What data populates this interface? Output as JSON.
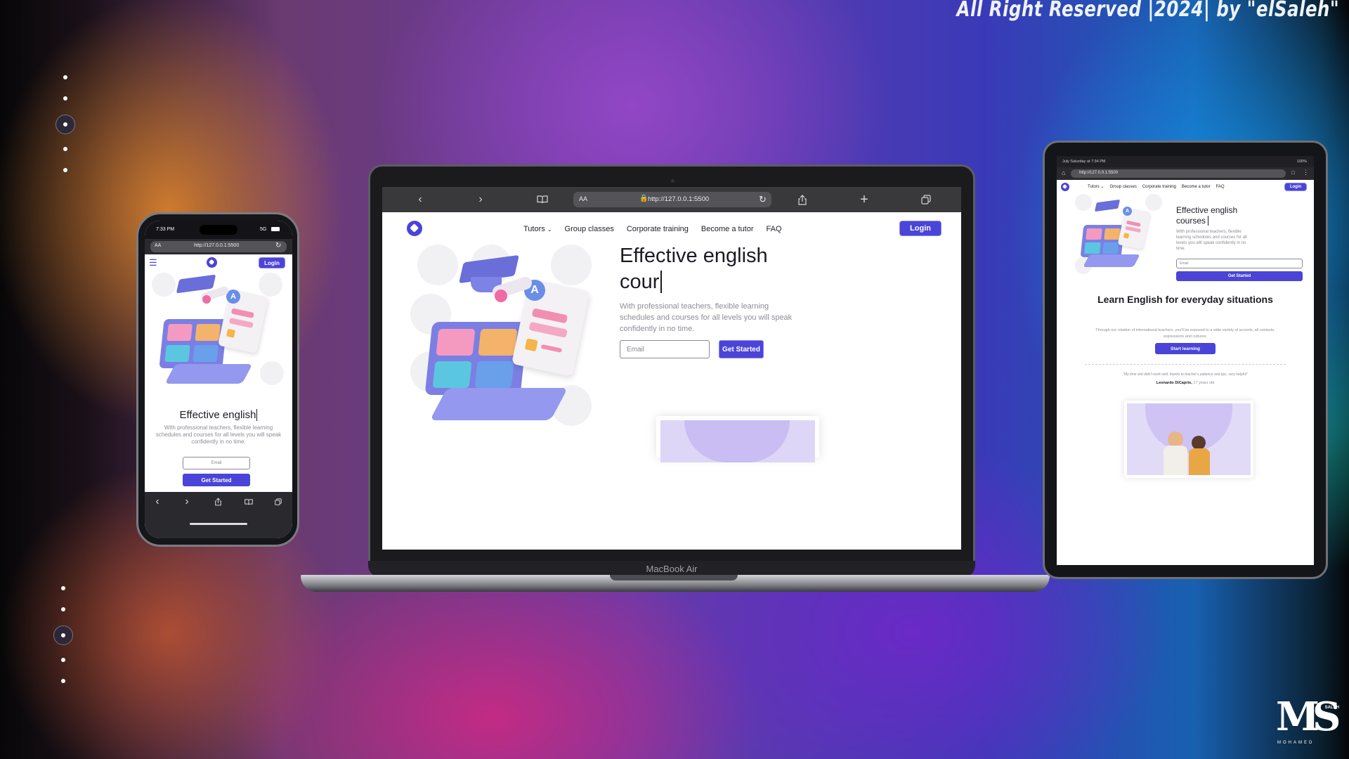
{
  "credit": "All Right Reserved |2024| by \"elSaleh\"",
  "brand": {
    "mark": "MS",
    "sub_top": "SALEH",
    "sub_bottom": "MOHAMED"
  },
  "colors": {
    "accent": "#4a44d8",
    "text": "#1b1b24"
  },
  "laptop": {
    "model": "MacBook Air",
    "browser": {
      "aa": "AA",
      "url": "http://127.0.0.1:5500"
    },
    "nav": {
      "tutors": "Tutors",
      "group": "Group classes",
      "corporate": "Corporate training",
      "become": "Become a tutor",
      "faq": "FAQ",
      "login": "Login"
    },
    "hero": {
      "line1": "Effective english",
      "line2": "cour",
      "body": "With professional teachers, flexible learning schedules and courses for all levels you will speak confidently in no time.",
      "email_placeholder": "Email",
      "cta": "Get Started"
    }
  },
  "phone": {
    "time": "7:33 PM",
    "signal": "5G",
    "browser": {
      "aa": "AA",
      "url": "http://127.0.0.1:5500"
    },
    "login": "Login",
    "hero": {
      "title": "Effective english",
      "body": "With professional teachers, flexible learning schedules and courses for all levels you will speak confidently in no time.",
      "email_placeholder": "Email",
      "cta": "Get Started"
    }
  },
  "tablet": {
    "status": "July Saturday at 7:34 PM",
    "battery": "100%",
    "url": "http://127.0.0.1:5500",
    "nav": {
      "tutors": "Tutors",
      "group": "Group classes",
      "corporate": "Corporate training",
      "become": "Become a tutor",
      "faq": "FAQ",
      "login": "Login"
    },
    "hero": {
      "line1": "Effective english",
      "line2": "courses",
      "body": "With professional teachers, flexible learning schedules and courses for all levels you will speak confidently in no time.",
      "email_placeholder": "Email",
      "cta": "Get Started"
    },
    "section": {
      "title": "Learn English for everyday situations",
      "body": "Through our rotation of international teachers, you'll be exposed to a wide variety of accents, all contexts, expressions and cultures.",
      "cta": "Start learning"
    },
    "testimonial": {
      "quote": "\"My time slot didn't work well, thanks to teacher's patience and tips, very helpful\"",
      "author": "Leonardo DiCaprio,",
      "age": "17 years old"
    }
  }
}
